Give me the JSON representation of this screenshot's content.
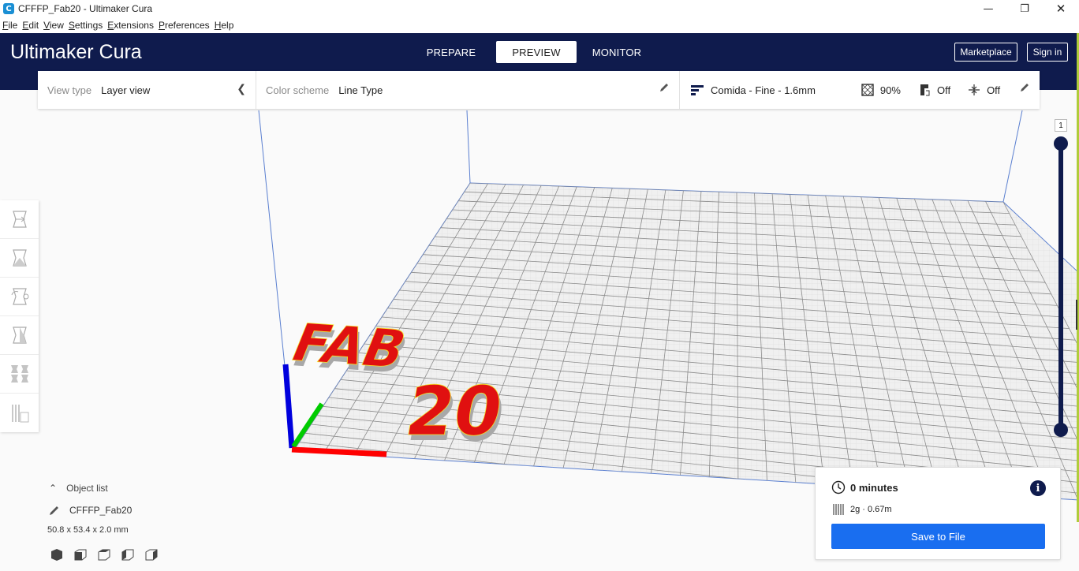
{
  "window": {
    "title": "CFFFP_Fab20 - Ultimaker Cura",
    "app_icon_letter": "C",
    "minimize": "—",
    "maximize": "❐",
    "close": "✕"
  },
  "menubar": {
    "items": [
      "File",
      "Edit",
      "View",
      "Settings",
      "Extensions",
      "Preferences",
      "Help"
    ]
  },
  "header": {
    "logo_bold": "Ultimaker",
    "logo_light": " Cura",
    "tabs": {
      "prepare": "PREPARE",
      "preview": "PREVIEW",
      "monitor": "MONITOR"
    },
    "active_tab": "preview",
    "marketplace": "Marketplace",
    "signin": "Sign in",
    "background_color": "#0f1b4d"
  },
  "toolbar": {
    "view_type_label": "View type",
    "view_type_value": "Layer view",
    "color_scheme_label": "Color scheme",
    "color_scheme_value": "Line Type",
    "profile": "Comida - Fine - 1.6mm",
    "infill": "90%",
    "support": "Off",
    "adhesion": "Off"
  },
  "tools": [
    "move-tool-icon",
    "scale-tool-icon",
    "rotate-tool-icon",
    "mirror-tool-icon",
    "per-model-settings-icon",
    "support-blocker-icon"
  ],
  "viewport": {
    "model_text_line1": "FAB",
    "model_text_line2": "20",
    "model_color": "#e01010",
    "axis_colors": {
      "x": "#ff0000",
      "y": "#00cc00",
      "z": "#0000dd"
    }
  },
  "layer_slider": {
    "current_layer": "1",
    "color": "#0f1b4d"
  },
  "object_list": {
    "toggle_label": "Object list",
    "object_name": "CFFFP_Fab20",
    "dimensions": "50.8 x 53.4 x 2.0 mm"
  },
  "print_info": {
    "time": "0 minutes",
    "material": "2g · 0.67m",
    "save_button": "Save to File",
    "accent": "#196ef0"
  }
}
